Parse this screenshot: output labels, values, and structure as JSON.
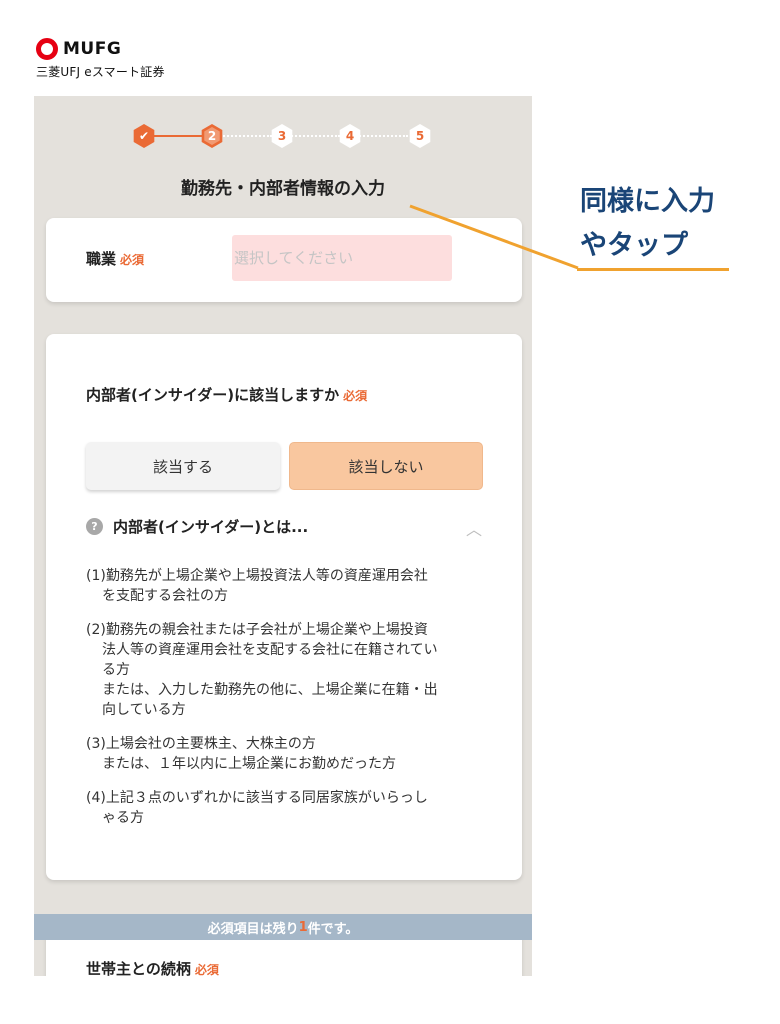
{
  "logo": {
    "brand": "MUFG",
    "sub": "三菱UFJ eスマート証券"
  },
  "stepper": {
    "steps": [
      "✔",
      "2",
      "3",
      "4",
      "5"
    ],
    "current": 2
  },
  "page": {
    "title": "勤務先・内部者情報の入力"
  },
  "required_tag": "必須",
  "occupation": {
    "label": "職業",
    "placeholder": "選択してください"
  },
  "insider": {
    "question": "内部者(インサイダー)に該当しますか",
    "yes_label": "該当する",
    "no_label": "該当しない",
    "selected": "該当しない",
    "faq_icon": "?",
    "faq_title": "内部者(インサイダー)とは...",
    "faq_items": [
      {
        "lines": [
          "(1)勤務先が上場企業や上場投資法人等の資産運用会社",
          "を支配する会社の方"
        ]
      },
      {
        "lines": [
          "(2)勤務先の親会社または子会社が上場企業や上場投資",
          "法人等の資産運用会社を支配する会社に在籍されてい",
          "る方",
          "または、入力した勤務先の他に、上場企業に在籍・出",
          "向している方"
        ]
      },
      {
        "lines": [
          "(3)上場会社の主要株主、大株主の方",
          "または、１年以内に上場企業にお勤めだった方"
        ]
      },
      {
        "lines": [
          "(4)上記３点のいずれかに該当する同居家族がいらっし",
          "ゃる方"
        ]
      }
    ]
  },
  "banner": {
    "prefix": "必須項目は残り",
    "count": "1",
    "suffix": "件です。"
  },
  "household": {
    "label": "世帯主との続柄"
  },
  "annotation": {
    "line1": "同様に入力",
    "line2": "やタップ",
    "color": "#1a4577",
    "line_color": "#f0a22f"
  },
  "colors": {
    "accent": "#ea6a35",
    "background": "#e4e1dc"
  }
}
